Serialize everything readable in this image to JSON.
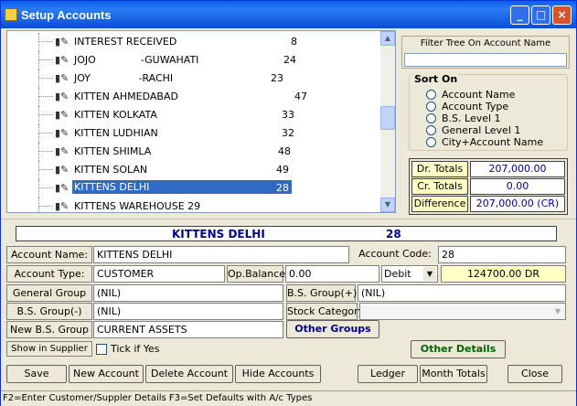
{
  "window": {
    "title": "Setup Accounts"
  },
  "tree": {
    "rows": [
      {
        "name": "INTEREST RECEIVED",
        "num": "8"
      },
      {
        "name": "JOJO              -GUWAHATI",
        "num": "24"
      },
      {
        "name": "JOY               -RACHI",
        "num": "23"
      },
      {
        "name": "KITTEN AHMEDABAD",
        "num": "47"
      },
      {
        "name": "KITTEN KOLKATA",
        "num": "33"
      },
      {
        "name": "KITTEN LUDHIAN",
        "num": "32"
      },
      {
        "name": "KITTEN SHIMLA",
        "num": "48"
      },
      {
        "name": "KITTEN SOLAN",
        "num": "49"
      },
      {
        "name": "KITTENS DELHI",
        "num": "28"
      },
      {
        "name": "KITTENS WAREHOUSE 29",
        "num": ""
      }
    ],
    "selected_index": 8
  },
  "filter": {
    "label": "Filter Tree On Account Name",
    "value": ""
  },
  "sort_on": {
    "title": "Sort On",
    "options": [
      "Account Name",
      "Account Type",
      "B.S. Level 1",
      "General Level 1",
      "City+Account Name"
    ]
  },
  "totals": {
    "dr_label": "Dr. Totals",
    "dr_value": "207,000.00",
    "cr_label": "Cr. Totals",
    "cr_value": "0.00",
    "diff_label": "Difference",
    "diff_value": "207,000.00 (CR)"
  },
  "header": {
    "name": "KITTENS DELHI",
    "code": "28"
  },
  "form": {
    "account_name_label": "Account Name:",
    "account_name": "KITTENS DELHI",
    "account_code_label": "Account Code:",
    "account_code": "28",
    "account_type_label": "Account Type:",
    "account_type": "CUSTOMER",
    "op_balance_label": "Op.Balance:",
    "op_balance": "0.00",
    "debit_credit": "Debit",
    "balance_display": "124700.00 DR",
    "general_group_label": "General Group",
    "general_group": "(NIL)",
    "bs_group_plus_label": "B.S. Group(+)",
    "bs_group_plus": "(NIL)",
    "bs_group_minus_label": "B.S. Group(-)",
    "bs_group_minus": "(NIL)",
    "stock_category_label": "Stock Category",
    "stock_category": "",
    "new_bs_group_label": "New B.S. Group",
    "new_bs_group": "CURRENT ASSETS",
    "other_groups_label": "Other Groups",
    "show_in_supplier_label": "Show in Supplier",
    "tick_if_yes_label": "Tick if Yes",
    "other_details_label": "Other Details"
  },
  "buttons": {
    "save": "Save",
    "new_account": "New Account",
    "delete_account": "Delete Account",
    "hide_accounts": "Hide Accounts",
    "ledger": "Ledger",
    "month_totals": "Month Totals",
    "close": "Close"
  },
  "status": "F2=Enter Customer/Suppler Details   F3=Set Defaults with A/c Types",
  "colors": {
    "titlebar": "#0a5fe8",
    "selection": "#316ac5",
    "balance_bg": "#ffffc4",
    "other_details_text": "#006400"
  }
}
